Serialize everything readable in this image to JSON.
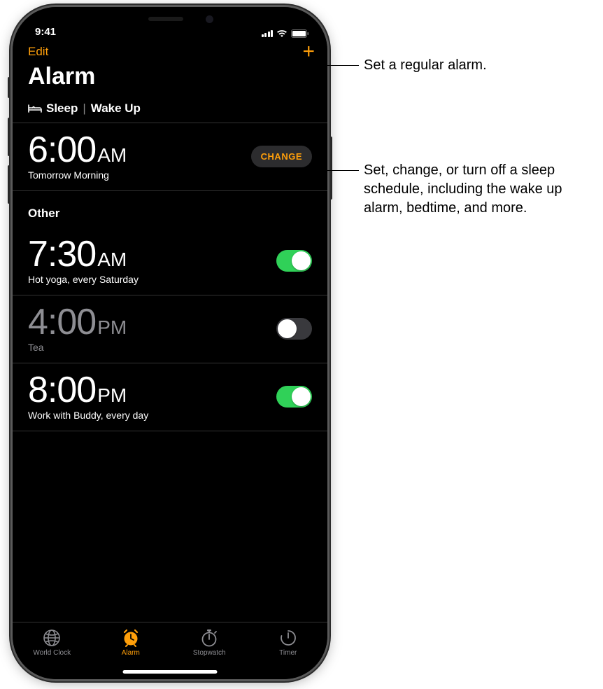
{
  "status_bar": {
    "time": "9:41"
  },
  "nav": {
    "edit_label": "Edit",
    "add_label": "+"
  },
  "page": {
    "title": "Alarm"
  },
  "sleep_section": {
    "header_part1": "Sleep",
    "header_part2": "Wake Up",
    "time": "6:00",
    "ampm": "AM",
    "subtitle": "Tomorrow Morning",
    "change_label": "CHANGE"
  },
  "other_section": {
    "header": "Other",
    "alarms": [
      {
        "time": "7:30",
        "ampm": "AM",
        "label": "Hot yoga, every Saturday",
        "enabled": true
      },
      {
        "time": "4:00",
        "ampm": "PM",
        "label": "Tea",
        "enabled": false
      },
      {
        "time": "8:00",
        "ampm": "PM",
        "label": "Work with Buddy, every day",
        "enabled": true
      }
    ]
  },
  "tabs": [
    {
      "label": "World Clock",
      "icon": "globe",
      "active": false
    },
    {
      "label": "Alarm",
      "icon": "alarm",
      "active": true
    },
    {
      "label": "Stopwatch",
      "icon": "stopwatch",
      "active": false
    },
    {
      "label": "Timer",
      "icon": "timer",
      "active": false
    }
  ],
  "callouts": {
    "c1": "Set a regular alarm.",
    "c2": "Set, change, or turn off a sleep schedule, including the wake up alarm, bedtime, and more."
  }
}
